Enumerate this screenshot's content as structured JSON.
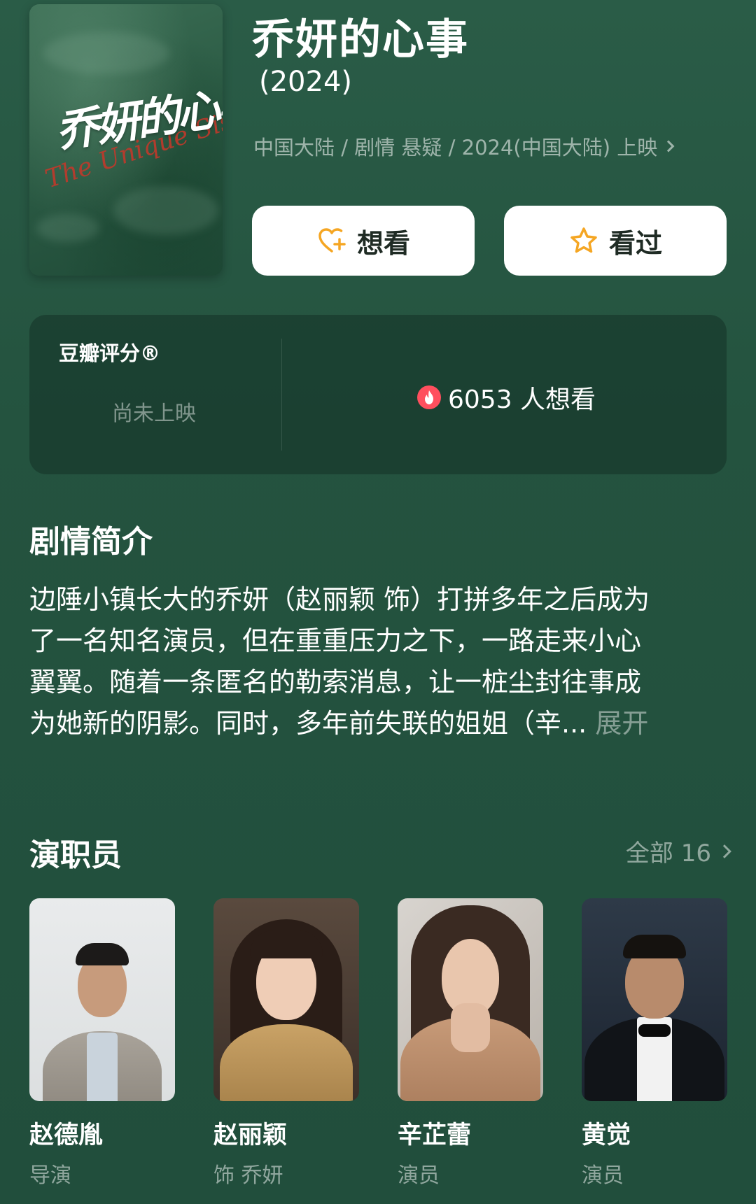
{
  "movie": {
    "title": "乔妍的心事",
    "year": "(2024)",
    "meta": "中国大陆 / 剧情 悬疑 / 2024(中国大陆) 上映",
    "poster": {
      "title": "乔妍的心事",
      "subtitle": "The Unique Sister"
    }
  },
  "actions": {
    "want_label": "想看",
    "seen_label": "看过",
    "want_icon": "heart-plus-icon",
    "seen_icon": "star-outline-icon",
    "icon_color": "#f5a623"
  },
  "rating": {
    "label": "豆瓣评分®",
    "status": "尚未上映",
    "wish_count": "6053 人想看",
    "wish_icon": "flame-icon",
    "wish_icon_color": "#ff4f5e"
  },
  "synopsis": {
    "title": "剧情简介",
    "lines": [
      "边陲小镇长大的乔妍（赵丽颖 饰）打拼多年之后成为",
      "了一名知名演员，但在重重压力之下，一路走来小心",
      "翼翼。随着一条匿名的勒索消息，让一桩尘封往事成",
      "为她新的阴影。同时，多年前失联的姐姐（辛..."
    ],
    "expand_label": "展开"
  },
  "cast": {
    "title": "演职员",
    "all_label": "全部 16",
    "members": [
      {
        "name": "赵德胤",
        "role": "导演"
      },
      {
        "name": "赵丽颖",
        "role": "饰 乔妍"
      },
      {
        "name": "辛芷蕾",
        "role": "演员"
      },
      {
        "name": "黄觉",
        "role": "演员"
      }
    ]
  },
  "colors": {
    "background": "#24533f",
    "card": "#1a3f30",
    "accent": "#f5a623"
  }
}
